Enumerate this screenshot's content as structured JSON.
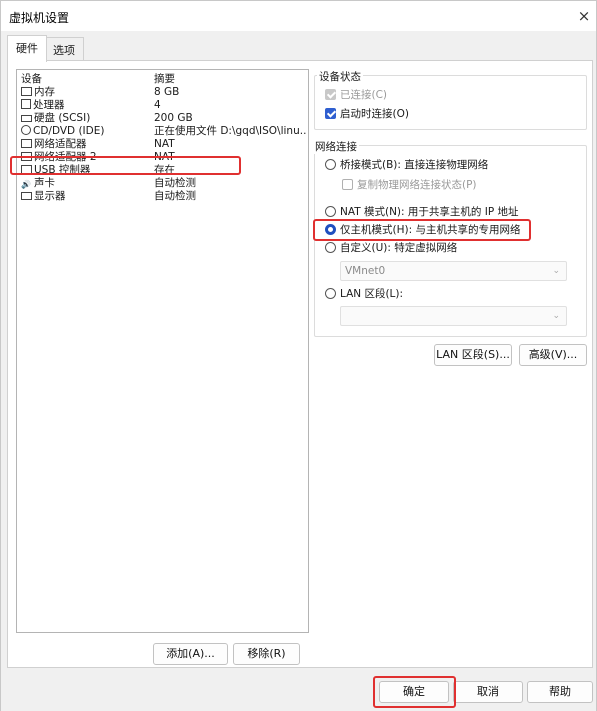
{
  "window": {
    "title": "虚拟机设置",
    "close_glyph": "×"
  },
  "tabs": [
    {
      "label": "硬件",
      "active": true
    },
    {
      "label": "选项",
      "active": false
    }
  ],
  "device_list": {
    "header": {
      "name": "设备",
      "summary": "摘要"
    },
    "items": [
      {
        "icon": "memory-icon",
        "name": "内存",
        "summary": "8 GB"
      },
      {
        "icon": "processor-icon",
        "name": "处理器",
        "summary": "4"
      },
      {
        "icon": "hard-disk-icon",
        "name": "硬盘 (SCSI)",
        "summary": "200 GB"
      },
      {
        "icon": "cd-dvd-icon",
        "name": "CD/DVD (IDE)",
        "summary": "正在使用文件 D:\\gqd\\ISO\\linu..."
      },
      {
        "icon": "network-adapter-icon",
        "name": "网络适配器",
        "summary": "NAT"
      },
      {
        "icon": "network-adapter-icon",
        "name": "网络适配器 2",
        "summary": "NAT",
        "selected": true
      },
      {
        "icon": "usb-icon",
        "name": "USB 控制器",
        "summary": "存在"
      },
      {
        "icon": "sound-card-icon",
        "name": "声卡",
        "summary": "自动检测"
      },
      {
        "icon": "display-icon",
        "name": "显示器",
        "summary": "自动检测"
      }
    ],
    "add_label": "添加(A)...",
    "remove_label": "移除(R)"
  },
  "device_status": {
    "title": "设备状态",
    "connected": {
      "label": "已连接(C)",
      "checked": true,
      "disabled": true
    },
    "connect_on_power": {
      "label": "启动时连接(O)",
      "checked": true
    }
  },
  "network": {
    "title": "网络连接",
    "bridged": {
      "label": "桥接模式(B): 直接连接物理网络",
      "selected": false
    },
    "replicate": {
      "label": "复制物理网络连接状态(P)",
      "checked": false,
      "disabled": true
    },
    "nat": {
      "label": "NAT 模式(N): 用于共享主机的 IP 地址",
      "selected": false
    },
    "host_only": {
      "label": "仅主机模式(H): 与主机共享的专用网络",
      "selected": true
    },
    "custom": {
      "label": "自定义(U): 特定虚拟网络",
      "selected": false
    },
    "custom_select": "VMnet0",
    "lan_segment": {
      "label": "LAN 区段(L):",
      "selected": false
    },
    "lan_select": "",
    "lan_segments_button": "LAN 区段(S)...",
    "advanced_button": "高级(V)..."
  },
  "footer": {
    "ok": "确定",
    "cancel": "取消",
    "help": "帮助"
  },
  "colors": {
    "accent": "#1f4fbf",
    "highlight": "#e03030"
  }
}
